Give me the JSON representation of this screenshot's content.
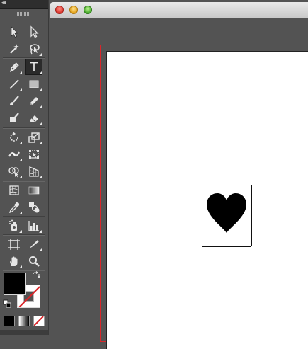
{
  "tools_panel": {
    "collapse_glyph": "◂◂",
    "tools": [
      {
        "name": "selection-tool",
        "icon": "selection-arrow-icon"
      },
      {
        "name": "direct-selection-tool",
        "icon": "direct-selection-arrow-icon"
      },
      {
        "name": "magic-wand-tool",
        "icon": "magic-wand-icon"
      },
      {
        "name": "lasso-tool",
        "icon": "lasso-icon"
      },
      {
        "name": "pen-tool",
        "icon": "pen-icon"
      },
      {
        "name": "type-tool",
        "icon": "type-icon",
        "glyph": "T",
        "active": true
      },
      {
        "name": "line-segment-tool",
        "icon": "line-icon"
      },
      {
        "name": "rectangle-tool",
        "icon": "rectangle-icon"
      },
      {
        "name": "paintbrush-tool",
        "icon": "paintbrush-icon"
      },
      {
        "name": "pencil-tool",
        "icon": "pencil-icon"
      },
      {
        "name": "blob-brush-tool",
        "icon": "blob-brush-icon"
      },
      {
        "name": "eraser-tool",
        "icon": "eraser-icon"
      },
      {
        "name": "rotate-tool",
        "icon": "rotate-icon"
      },
      {
        "name": "scale-tool",
        "icon": "scale-icon"
      },
      {
        "name": "width-tool",
        "icon": "width-icon"
      },
      {
        "name": "free-transform-tool",
        "icon": "free-transform-icon"
      },
      {
        "name": "shape-builder-tool",
        "icon": "shape-builder-icon"
      },
      {
        "name": "perspective-grid-tool",
        "icon": "perspective-grid-icon"
      },
      {
        "name": "mesh-tool",
        "icon": "mesh-icon"
      },
      {
        "name": "gradient-tool",
        "icon": "gradient-icon"
      },
      {
        "name": "eyedropper-tool",
        "icon": "eyedropper-icon"
      },
      {
        "name": "blend-tool",
        "icon": "blend-icon"
      },
      {
        "name": "symbol-sprayer-tool",
        "icon": "symbol-sprayer-icon"
      },
      {
        "name": "column-graph-tool",
        "icon": "column-graph-icon"
      },
      {
        "name": "artboard-tool",
        "icon": "artboard-icon"
      },
      {
        "name": "slice-tool",
        "icon": "slice-icon"
      },
      {
        "name": "hand-tool",
        "icon": "hand-icon"
      },
      {
        "name": "zoom-tool",
        "icon": "zoom-icon"
      }
    ],
    "fill_color": "#000000",
    "stroke": "none",
    "drawing_modes": [
      "color",
      "gradient",
      "none"
    ]
  },
  "document_window": {
    "title": "",
    "controls": [
      "close",
      "minimize",
      "zoom"
    ],
    "bleed_color": "#d9262a",
    "artboard_color": "#ffffff",
    "artwork": {
      "shape": "heart",
      "fill": "#000000"
    }
  },
  "colors": {
    "ui_background": "#535353",
    "accent_red": "#d9262a"
  }
}
